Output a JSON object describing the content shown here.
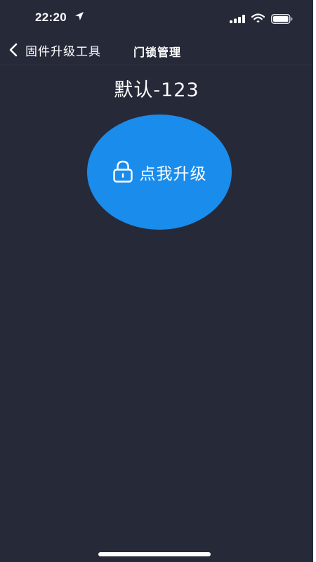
{
  "status_bar": {
    "time": "22:20",
    "icons": [
      "location-arrow-icon",
      "signal-icon",
      "wifi-icon",
      "battery-icon"
    ]
  },
  "nav": {
    "back_label": "固件升级工具",
    "title": "门锁管理"
  },
  "device": {
    "name": "默认-123"
  },
  "upgrade_button": {
    "label": "点我升级",
    "icon": "lock-icon"
  },
  "colors": {
    "background": "#262938",
    "accent": "#1a8cec",
    "text": "#ffffff"
  }
}
